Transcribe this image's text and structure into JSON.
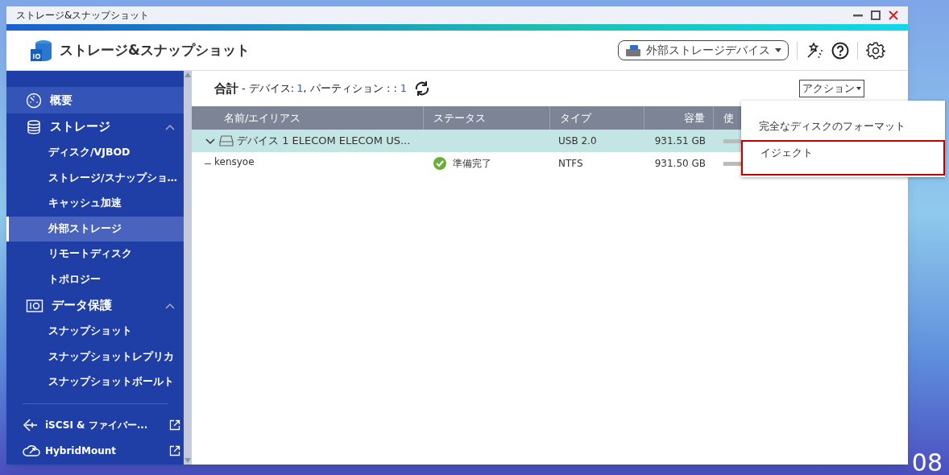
{
  "window": {
    "title": "ストレージ&スナップショット"
  },
  "header": {
    "app_title": "ストレージ&スナップショット",
    "device_selector": "外部ストレージデバイス"
  },
  "sidebar": {
    "items": [
      {
        "kind": "link",
        "label": "概要",
        "hovered": true
      },
      {
        "kind": "group",
        "label": "ストレージ",
        "expanded": true,
        "children": [
          {
            "label": "ディスク/VJBOD",
            "selected": false
          },
          {
            "label": "ストレージ/スナップショ…",
            "selected": false
          },
          {
            "label": "キャッシュ加速",
            "selected": false
          },
          {
            "label": "外部ストレージ",
            "selected": true
          },
          {
            "label": "リモートディスク",
            "selected": false
          },
          {
            "label": "トポロジー",
            "selected": false
          }
        ]
      },
      {
        "kind": "group",
        "label": "データ保護",
        "expanded": true,
        "children": [
          {
            "label": "スナップショット",
            "selected": false
          },
          {
            "label": "スナップショットレプリカ",
            "selected": false
          },
          {
            "label": "スナップショットボールト",
            "selected": false
          }
        ]
      },
      {
        "kind": "divider"
      },
      {
        "kind": "external",
        "label": "iSCSI & ファイバー..."
      },
      {
        "kind": "external",
        "label": "HybridMount"
      }
    ]
  },
  "summary": {
    "label": "合計",
    "devices_label": "- デバイス:",
    "devices": "1",
    "partitions_label": ", パーティション : :",
    "partitions": "1"
  },
  "action_button": "アクション",
  "table": {
    "columns": [
      "名前/エイリアス",
      "ステータス",
      "タイプ",
      "容量",
      "使"
    ],
    "rows": [
      {
        "kind": "device",
        "name": "デバイス 1 ELECOM ELECOM US...",
        "status": "",
        "type": "USB 2.0",
        "capacity": "931.51 GB",
        "expanded": true,
        "selected": true
      },
      {
        "kind": "partition",
        "name": "kensyoe",
        "status": "準備完了",
        "type": "NTFS",
        "capacity": "931.50 GB",
        "selected": false
      }
    ]
  },
  "action_menu": {
    "items": [
      {
        "label": "完全なディスクのフォーマット",
        "highlighted": false
      },
      {
        "label": "イジェクト",
        "highlighted": true
      }
    ]
  },
  "desktop_clock": "08"
}
